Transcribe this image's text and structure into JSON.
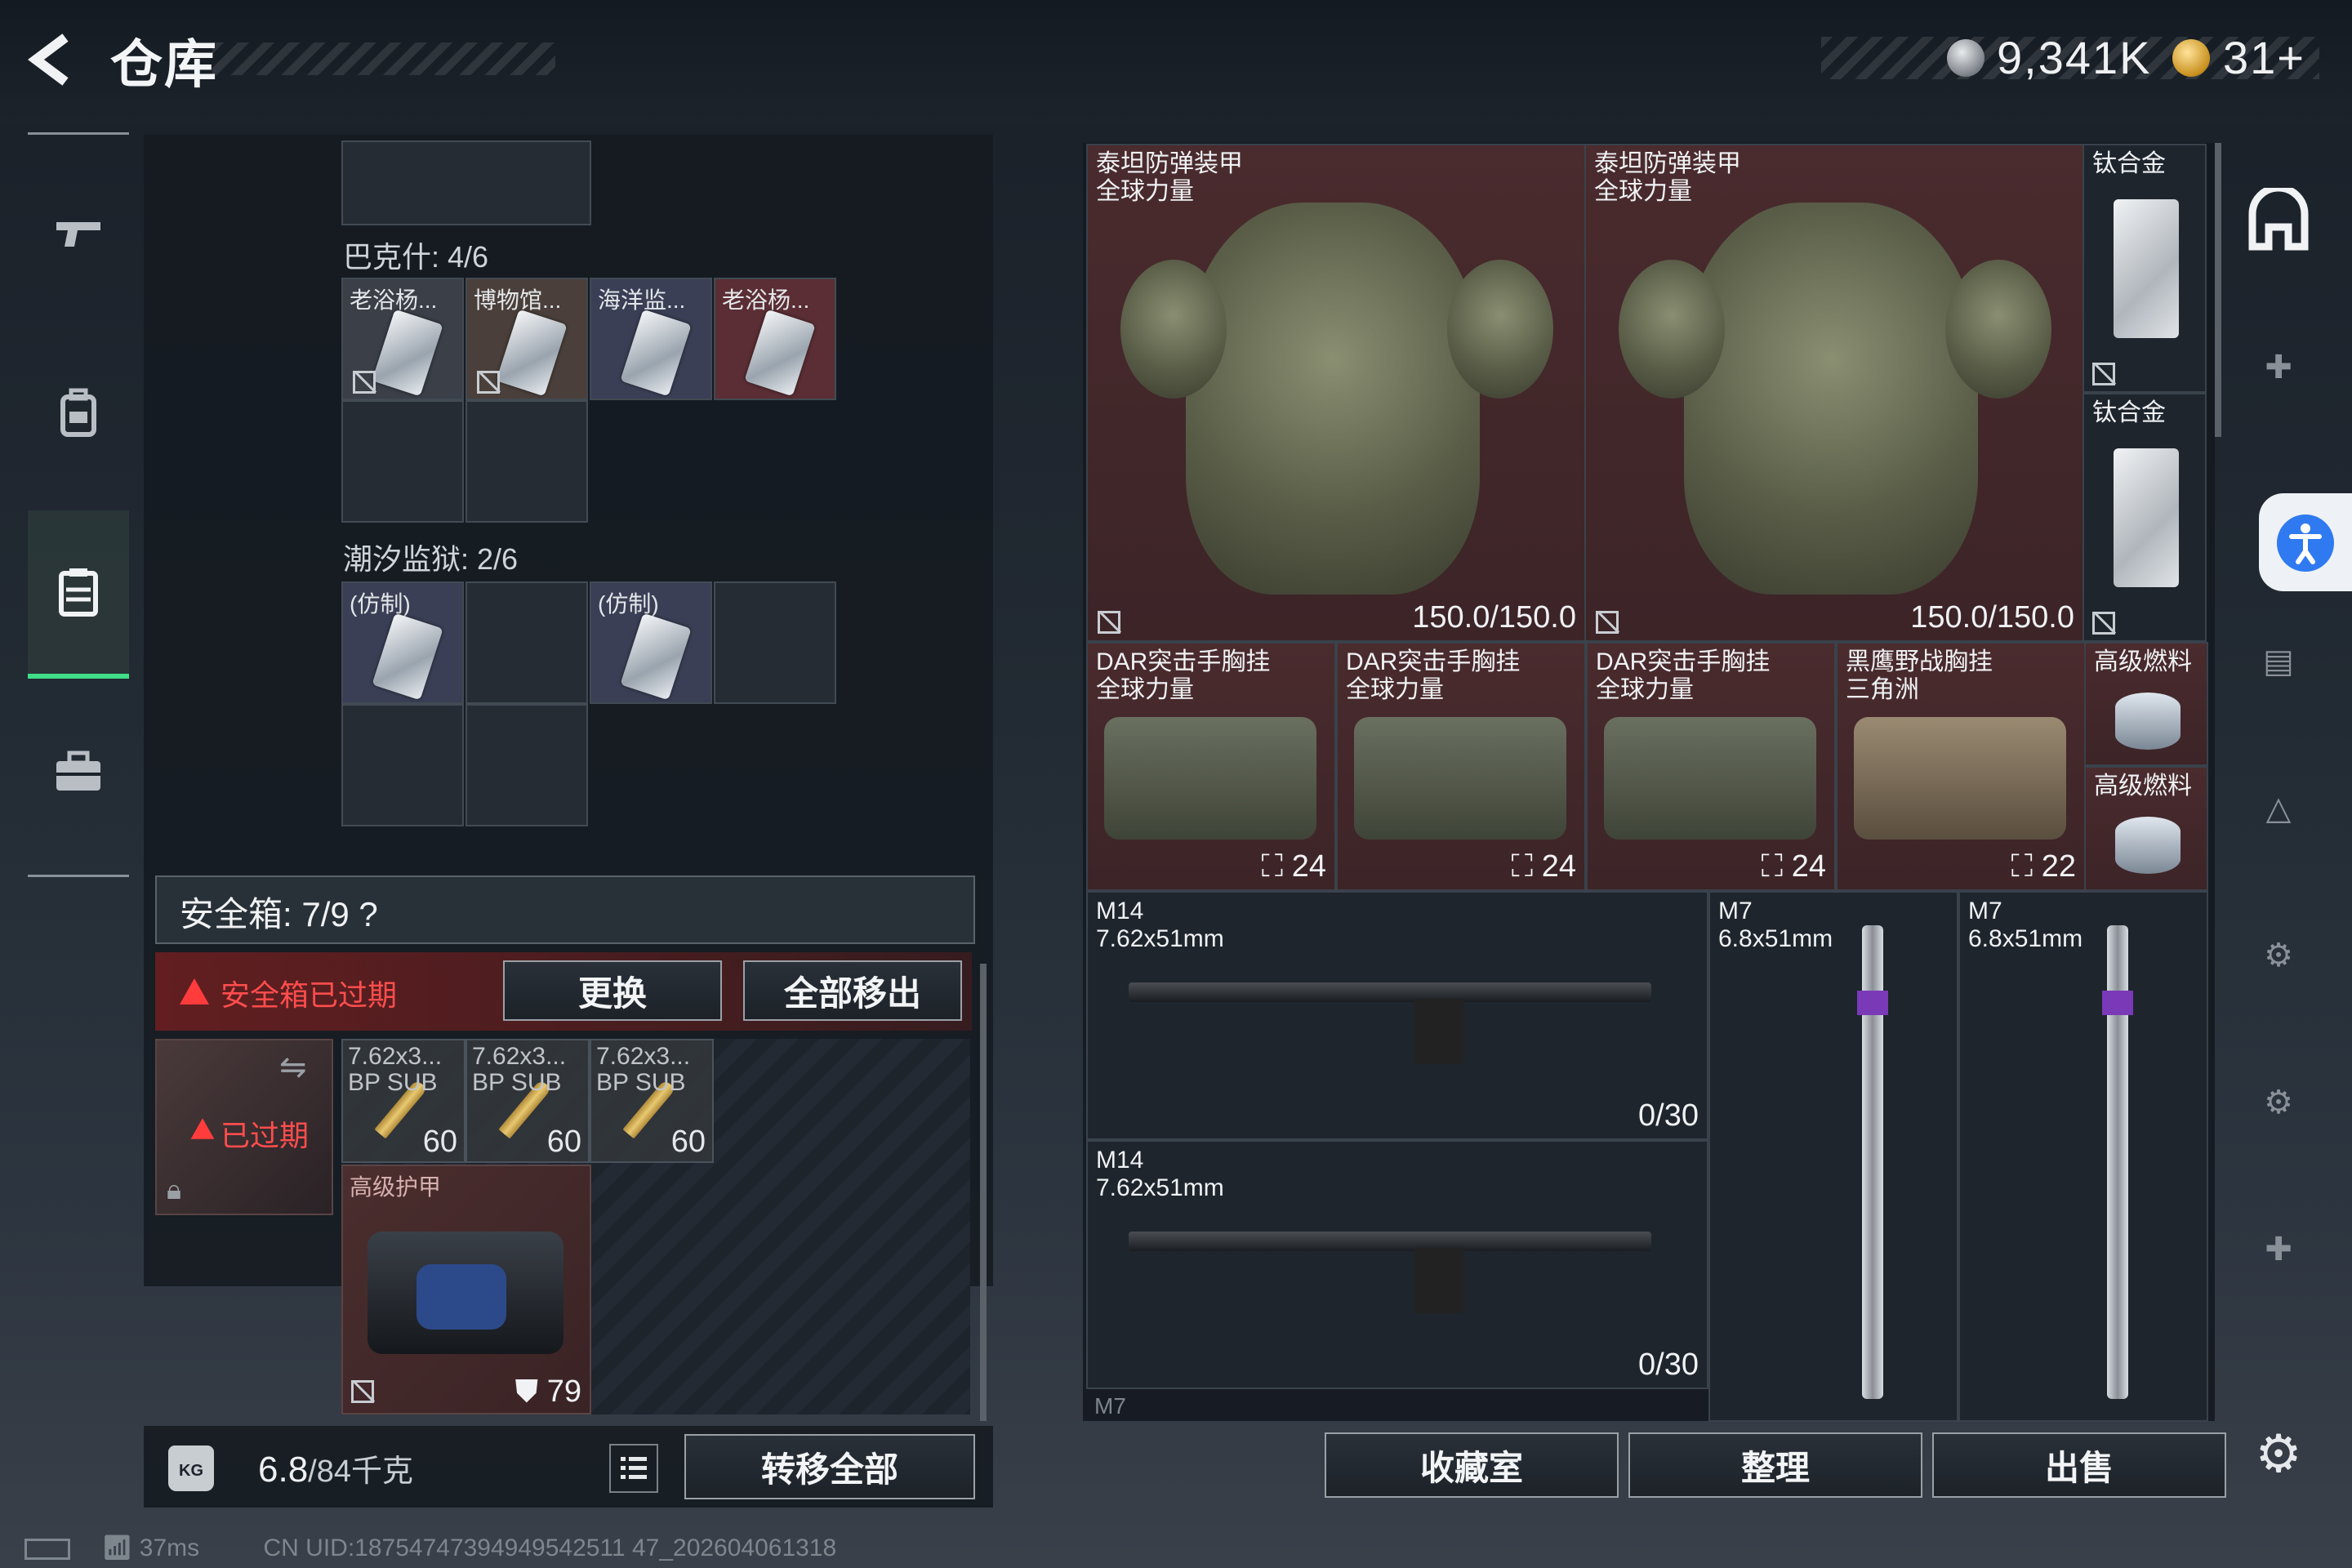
{
  "header": {
    "title": "仓库",
    "currency_silver": "9,341K",
    "currency_gold": "31+"
  },
  "left_nav": [
    "pistol-icon",
    "backpack-icon",
    "storage-icon",
    "case-icon"
  ],
  "stash_sections": [
    {
      "title": "巴克什: 4/6",
      "items": [
        {
          "label": "老浴杨..."
        },
        {
          "label": "博物馆..."
        },
        {
          "label": "海洋监..."
        },
        {
          "label": "老浴杨..."
        }
      ]
    },
    {
      "title": "潮汐监狱: 2/6",
      "items": [
        {
          "label": "(仿制)"
        },
        {
          "label": "(仿制)"
        }
      ]
    }
  ],
  "safebox": {
    "title": "安全箱: 7/9",
    "help": "?",
    "expired_notice": "安全箱已过期",
    "replace_label": "更换",
    "remove_all_label": "全部移出",
    "expired_badge": "已过期",
    "ammo": [
      {
        "name1": "7.62x3...",
        "name2": "BP SUB",
        "count": "60"
      },
      {
        "name1": "7.62x3...",
        "name2": "BP SUB",
        "count": "60"
      },
      {
        "name1": "7.62x3...",
        "name2": "BP SUB",
        "count": "60"
      }
    ],
    "bag": {
      "name": "高级护甲",
      "durability": "79"
    }
  },
  "weight": {
    "current": "6.8",
    "max": "/84千克",
    "unit_icon": "KG",
    "transfer_all": "转移全部"
  },
  "status": {
    "ping": "37ms",
    "uid": "CN UID:18754747394949542511 47_202604061318"
  },
  "inventory": {
    "armor": [
      {
        "name": "泰坦防弹装甲",
        "sub": "全球力量",
        "value": "150.0/150.0"
      },
      {
        "name": "泰坦防弹装甲",
        "sub": "全球力量",
        "value": "150.0/150.0"
      }
    ],
    "plates": [
      {
        "name": "钛合金"
      },
      {
        "name": "钛合金"
      }
    ],
    "rigs": [
      {
        "name": "DAR突击手胸挂",
        "sub": "全球力量",
        "value": "24"
      },
      {
        "name": "DAR突击手胸挂",
        "sub": "全球力量",
        "value": "24"
      },
      {
        "name": "DAR突击手胸挂",
        "sub": "全球力量",
        "value": "24"
      },
      {
        "name": "黑鹰野战胸挂",
        "sub": "三角洲",
        "value": "22"
      }
    ],
    "fuel": [
      {
        "name": "高级燃料"
      },
      {
        "name": "高级燃料"
      }
    ],
    "rifles": [
      {
        "name": "M14",
        "cal": "7.62x51mm",
        "ammo": "0/30"
      },
      {
        "name": "M14",
        "cal": "7.62x51mm",
        "ammo": "0/30"
      }
    ],
    "m7": [
      {
        "name": "M7",
        "cal": "6.8x51mm"
      },
      {
        "name": "M7",
        "cal": "6.8x51mm"
      }
    ],
    "partial_label": "M7"
  },
  "bottom_tabs": {
    "collection": "收藏室",
    "organize": "整理",
    "sell": "出售"
  }
}
